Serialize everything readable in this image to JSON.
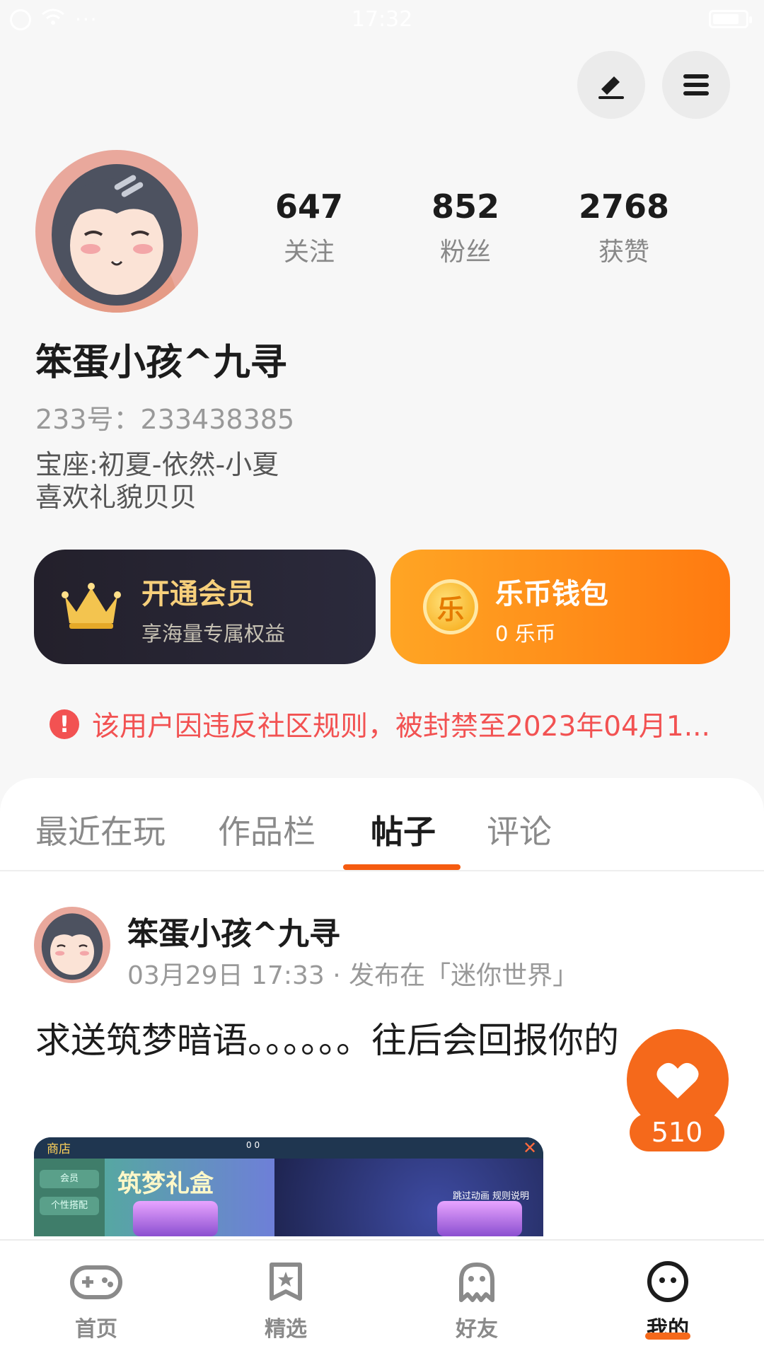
{
  "status_bar": {
    "time": "17:32"
  },
  "profile": {
    "username": "笨蛋小孩^九寻",
    "uid": "233号：233438385",
    "bio_line1": "宝座:初夏-依然-小夏",
    "bio_line2": "喜欢礼貌贝贝",
    "stats": [
      {
        "value": "647",
        "label": "关注"
      },
      {
        "value": "852",
        "label": "粉丝"
      },
      {
        "value": "2768",
        "label": "获赞"
      }
    ]
  },
  "cards": {
    "vip": {
      "title": "开通会员",
      "subtitle": "享海量专属权益"
    },
    "wallet": {
      "title": "乐币钱包",
      "subtitle": "0 乐币",
      "icon_glyph": "乐"
    }
  },
  "ban_notice": {
    "icon": "!",
    "text": "该用户因违反社区规则，被封禁至2023年04月1..."
  },
  "tabs": [
    {
      "label": "最近在玩"
    },
    {
      "label": "作品栏"
    },
    {
      "label": "帖子",
      "active": true
    },
    {
      "label": "评论"
    }
  ],
  "post": {
    "author": "笨蛋小孩^九寻",
    "meta": "03月29日 17:33 · 发布在「迷你世界」",
    "text": "求送筑梦暗语。。。。。。往后会回报你的",
    "image": {
      "shop_label": "商店",
      "banner_text": "筑梦礼盒",
      "left_items": [
        "会员",
        "个性搭配"
      ],
      "skip_label": "跳过动画  规则说明",
      "top_values": "0                      0",
      "close_glyph": "✕"
    }
  },
  "like": {
    "count": "510"
  },
  "bottom_nav": [
    {
      "label": "首页",
      "icon": "gamepad-icon"
    },
    {
      "label": "精选",
      "icon": "star-bookmark-icon"
    },
    {
      "label": "好友",
      "icon": "ghost-icon"
    },
    {
      "label": "我的",
      "icon": "smiley-icon",
      "active": true
    }
  ],
  "colors": {
    "accent": "#f5691b",
    "ban_red": "#f25252",
    "vip_gold": "#f6cf7b",
    "wallet_orange": "#ff8a16"
  }
}
